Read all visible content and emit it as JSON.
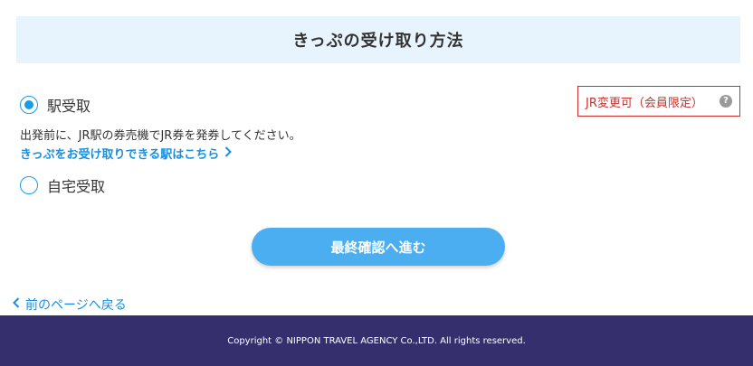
{
  "section": {
    "title": "きっぷの受け取り方法"
  },
  "options": [
    {
      "label": "駅受取",
      "selected": true
    },
    {
      "label": "自宅受取",
      "selected": false
    }
  ],
  "badge": {
    "text": "JR変更可（会員限定）",
    "icon": "question-circle-icon",
    "help_glyph": "?"
  },
  "description": "出発前に、JR駅の券売機でJR券を発券してください。",
  "stations_link": "きっぷをお受け取りできる駅はこちら",
  "primary_button": "最終確認へ進む",
  "back_link": "前のページへ戻る",
  "footer": {
    "copyright": "Copyright © NIPPON TRAVEL AGENCY Co.,LTD. All rights reserved."
  },
  "colors": {
    "accent": "#1a9be6",
    "link": "#1a8fe0",
    "button": "#4aaef0",
    "badge": "#c9302c",
    "header_bg": "#e8f4fd",
    "footer_bg": "#352f6e"
  }
}
